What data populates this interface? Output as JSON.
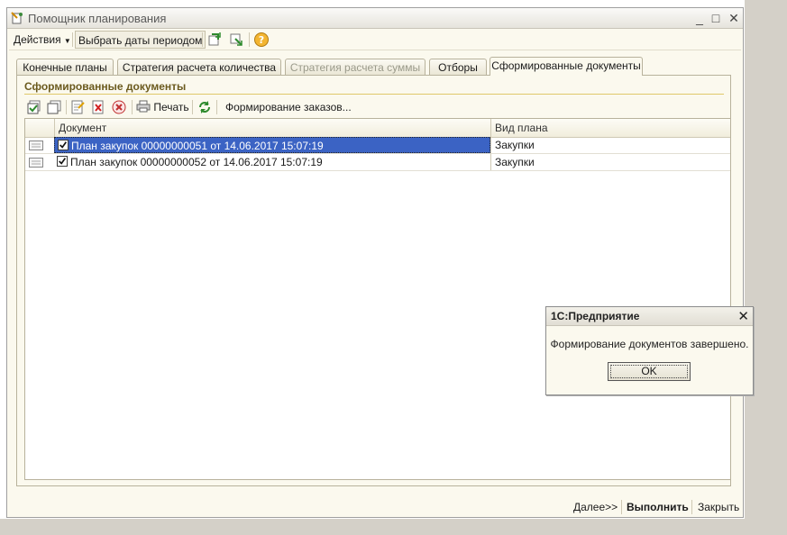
{
  "window": {
    "title": "Помощник планирования",
    "controls": {
      "minimize": "_",
      "maximize": "□",
      "close": "✕"
    }
  },
  "toolbar": {
    "actions_label": "Действия",
    "select_period_label": "Выбрать даты периодом",
    "icons": [
      "export-icon",
      "import-icon",
      "help-icon"
    ]
  },
  "tabs": [
    {
      "label": "Конечные планы",
      "state": "normal"
    },
    {
      "label": "Стратегия расчета количества",
      "state": "normal"
    },
    {
      "label": "Стратегия расчета суммы",
      "state": "disabled"
    },
    {
      "label": "Отборы",
      "state": "normal"
    },
    {
      "label": "Сформированные документы",
      "state": "active"
    }
  ],
  "section": {
    "title": "Сформированные документы",
    "toolbar": {
      "print_label": "Печать",
      "form_orders_label": "Формирование заказов..."
    }
  },
  "grid": {
    "columns": [
      "Документ",
      "Вид плана"
    ],
    "rows": [
      {
        "document": "План закупок 00000000051 от 14.06.2017 15:07:19",
        "plan_type": "Закупки",
        "checked": true,
        "selected": true
      },
      {
        "document": "План закупок 00000000052 от 14.06.2017 15:07:19",
        "plan_type": "Закупки",
        "checked": true,
        "selected": false
      }
    ]
  },
  "bottom": {
    "next_label": "Далее>>",
    "run_label": "Выполнить",
    "close_label": "Закрыть"
  },
  "dialog": {
    "title": "1С:Предприятие",
    "message": "Формирование документов завершено.",
    "ok_label": "OK",
    "close_glyph": "✕"
  },
  "colors": {
    "selection": "#3b63c4",
    "section_title": "#6b5a1e",
    "window_bg": "#fbf9ee"
  }
}
